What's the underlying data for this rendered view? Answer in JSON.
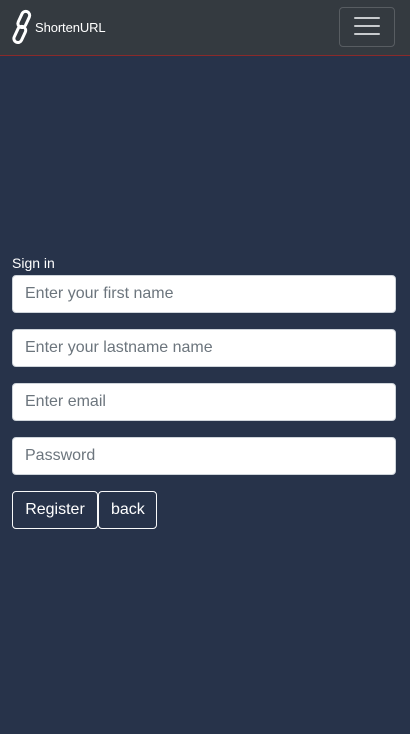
{
  "navbar": {
    "brand_text": "ShortenURL",
    "brand_icon": "link-chain-icon",
    "toggler_icon": "hamburger-menu-icon"
  },
  "form": {
    "title": "Sign in",
    "first_name": {
      "placeholder": "Enter your first name",
      "value": ""
    },
    "last_name": {
      "placeholder": "Enter your lastname name",
      "value": ""
    },
    "email": {
      "placeholder": "Enter email",
      "value": ""
    },
    "password": {
      "placeholder": "Password",
      "value": ""
    },
    "register_label": "Register",
    "back_label": "back"
  },
  "colors": {
    "page_background": "#27334a",
    "navbar_background": "#343a40",
    "navbar_border": "#8a2a2a",
    "text_light": "#ffffff"
  }
}
